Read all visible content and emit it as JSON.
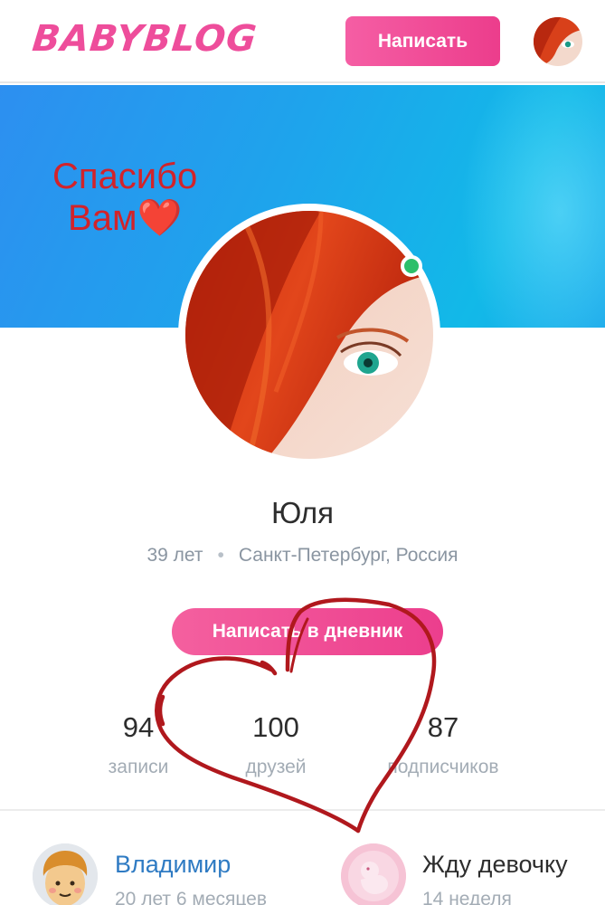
{
  "header": {
    "logo": "BABYBLOG",
    "write_label": "Написать"
  },
  "cover": {
    "note_line1": "Спасибо",
    "note_line2": "Вам❤️"
  },
  "profile": {
    "name": "Юля",
    "age": "39 лет",
    "location": "Санкт-Петербург, Россия",
    "diary_button": "Написать в дневник",
    "online": true
  },
  "stats": [
    {
      "value": "94",
      "label": "записи"
    },
    {
      "value": "100",
      "label": "друзей"
    },
    {
      "value": "87",
      "label": "подписчиков"
    }
  ],
  "cards": {
    "husband": {
      "name": "Владимир",
      "age": "20 лет 6 месяцев"
    },
    "pregnancy": {
      "title": "Жду девочку",
      "weeks": "14 неделя"
    }
  },
  "colors": {
    "brand_pink": "#ee4d9b",
    "link_blue": "#2f7bc3",
    "online_green": "#2dbf6a",
    "annotation_red": "#b0181d"
  }
}
